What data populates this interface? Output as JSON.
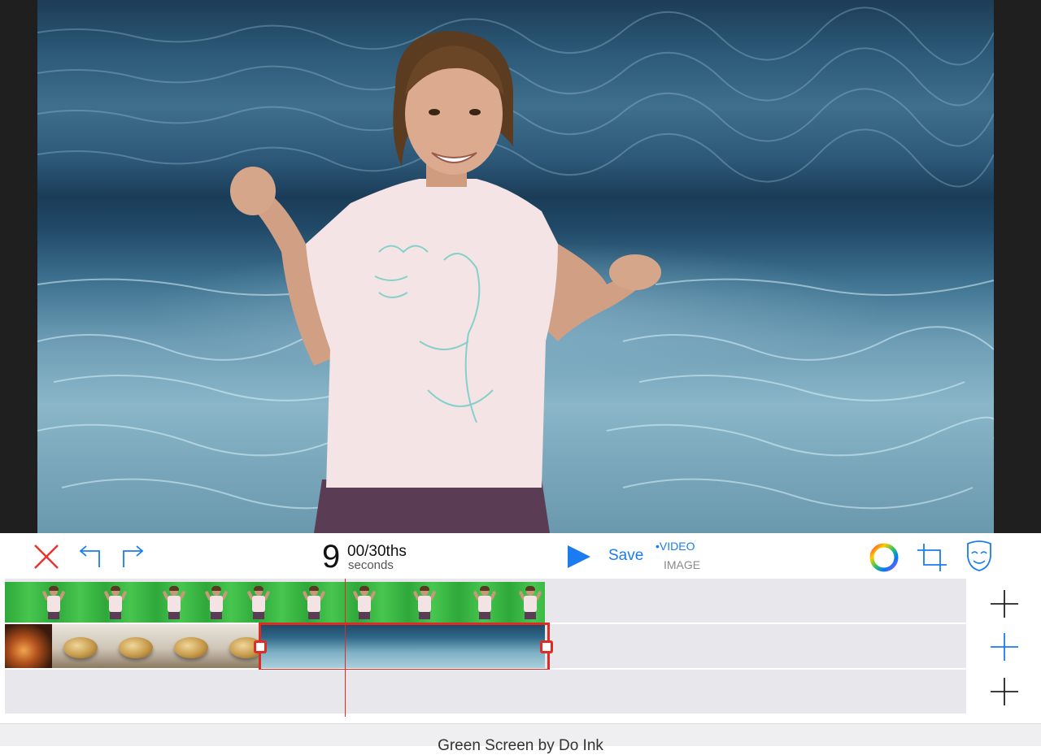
{
  "preview": {
    "alt": "Girl in a pink T-shirt composited over an underwater background"
  },
  "toolbar": {
    "time_seconds": "9",
    "time_fraction": "00/30ths",
    "time_unit": "seconds",
    "save_label": "Save",
    "mode_video": "•VIDEO",
    "mode_image": "IMAGE",
    "icons": {
      "close": "close-icon",
      "undo": "undo-icon",
      "redo": "redo-icon",
      "play": "play-icon",
      "color_wheel": "color-wheel-icon",
      "crop": "crop-icon",
      "mask": "mask-icon"
    },
    "colors": {
      "close": "#e8342b",
      "accent": "#1a7cf0",
      "inactive": "#8a8a8a"
    }
  },
  "timeline": {
    "tracks": [
      {
        "name": "foreground-video-track",
        "add_icon": "plus-icon",
        "add_active": false
      },
      {
        "name": "background-video-track",
        "add_icon": "plus-icon",
        "add_active": true
      },
      {
        "name": "empty-track",
        "add_icon": "plus-icon",
        "add_active": false
      }
    ],
    "selection_color": "#e02a22"
  },
  "footer": {
    "title": "Green Screen by Do Ink"
  }
}
